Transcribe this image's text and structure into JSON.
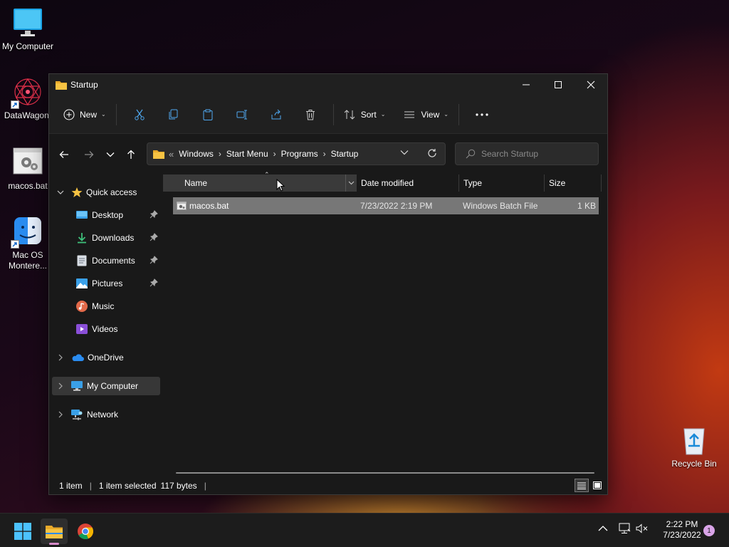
{
  "desktop": {
    "icons": [
      {
        "label": "My Computer"
      },
      {
        "label": "DataWagon."
      },
      {
        "label": "macos.bat"
      },
      {
        "label": "Mac OS Montere..."
      },
      {
        "label": "Recycle Bin"
      }
    ]
  },
  "window": {
    "title": "Startup",
    "commands": {
      "new": "New",
      "sort": "Sort",
      "view": "View"
    },
    "address": {
      "overflow": "«",
      "crumbs": [
        "Windows",
        "Start Menu",
        "Programs",
        "Startup"
      ]
    },
    "search_placeholder": "Search Startup",
    "nav": {
      "quick_access": "Quick access",
      "pinned": [
        "Desktop",
        "Downloads",
        "Documents",
        "Pictures"
      ],
      "music": "Music",
      "videos": "Videos",
      "onedrive": "OneDrive",
      "my_computer": "My Computer",
      "network": "Network"
    },
    "columns": {
      "name": "Name",
      "date": "Date modified",
      "type": "Type",
      "size": "Size"
    },
    "files": [
      {
        "name": "macos.bat",
        "date": "7/23/2022 2:19 PM",
        "type": "Windows Batch File",
        "size": "1 KB"
      }
    ],
    "status": {
      "count": "1 item",
      "selected": "1 item selected",
      "size": "117 bytes"
    }
  },
  "taskbar": {
    "time": "2:22 PM",
    "date": "7/23/2022",
    "notifications": "1"
  },
  "colors": {
    "accent": "#0078d4",
    "folder": "#f6c343",
    "selected_row": "#777777"
  }
}
